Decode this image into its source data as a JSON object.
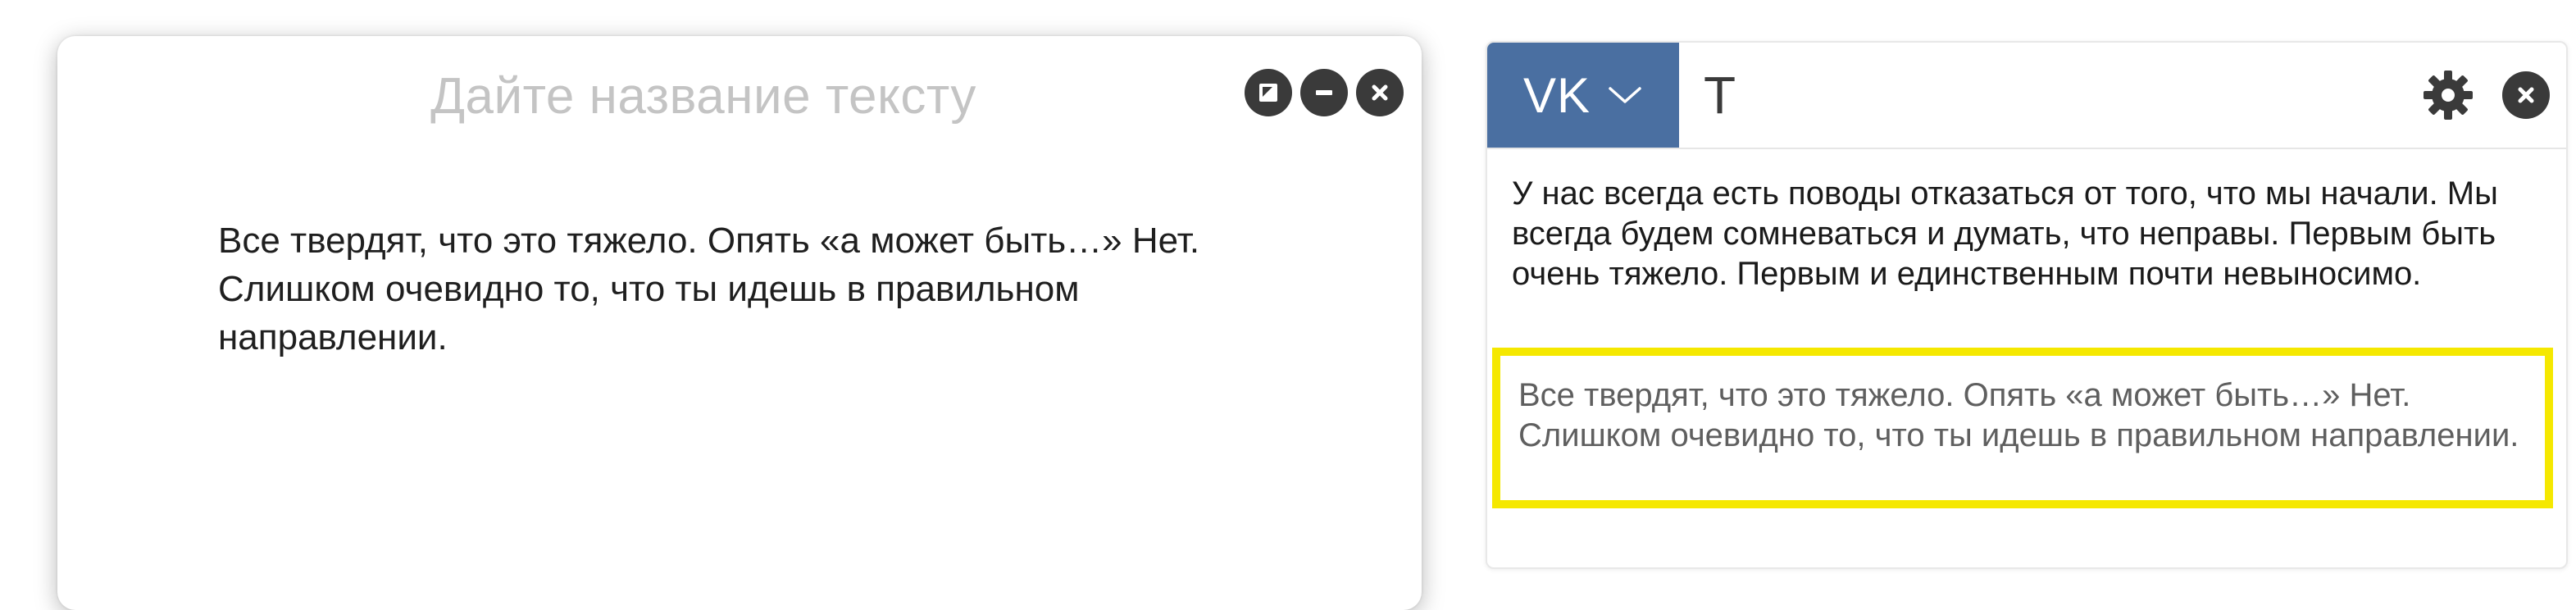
{
  "editor": {
    "title_placeholder": "Дайте название тексту",
    "body_text": "Все твердят, что это тяжело. Опять «а может быть…» Нет. Слишком очевидно то, что ты идешь в правильном направлении.",
    "controls": [
      "expand-icon",
      "minimize-icon",
      "close-icon"
    ]
  },
  "panel": {
    "tabs": [
      {
        "label": "VK",
        "active": true,
        "icon": "chevron-down-icon"
      },
      {
        "label": "T",
        "active": false
      }
    ],
    "header_icons": [
      "gear-icon",
      "close-icon"
    ],
    "current_text": "У нас всегда есть поводы отказаться от того, что мы начали. Мы всегда будем сомневаться и думать, что неправы. Первым быть очень тяжело. Первым и единственным почти невыносимо.",
    "highlighted_text": "Все твердят, что это тяжело. Опять «а может быть…» Нет. Слишком очевидно то, что ты идешь в правильном направлении."
  },
  "colors": {
    "vk_tab_bg": "#4a6fa1",
    "highlight_border": "#f5e800",
    "title_placeholder": "#c4c4c4",
    "icon_dark": "#3a3a3a"
  }
}
